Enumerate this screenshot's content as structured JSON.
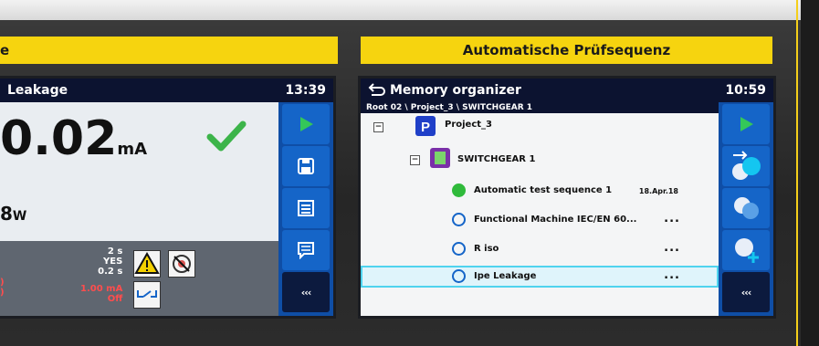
{
  "panels": {
    "left_label": "e",
    "right_label": "Automatische Prüfsequenz"
  },
  "left_screen": {
    "title": "Leakage",
    "time": "13:39",
    "main_value": "0.02",
    "main_unit": "mA",
    "power_value": "8",
    "power_unit": "W",
    "param_lines": [
      "2 s",
      "YES",
      "0.2 s"
    ],
    "limit_lines": [
      "1.00 mA",
      "Off"
    ],
    "left_red_lines": [
      ")",
      ")"
    ],
    "sidebar_last": "‹‹‹"
  },
  "right_screen": {
    "title": "Memory organizer",
    "time": "10:59",
    "path": "Root 02 \\ Project_3 \\ SWITCHGEAR 1",
    "tree": [
      {
        "label": "Project_3",
        "kind": "project"
      },
      {
        "label": "SWITCHGEAR 1",
        "kind": "switchgear"
      },
      {
        "label": "Automatic test sequence 1",
        "kind": "done",
        "date": "18.Apr.18"
      },
      {
        "label": "Functional Machine IEC/EN 60...",
        "kind": "empty",
        "dots": "..."
      },
      {
        "label": "R iso",
        "kind": "empty",
        "dots": "..."
      },
      {
        "label": "Ipe Leakage",
        "kind": "empty",
        "dots": "...",
        "selected": true
      }
    ],
    "sidebar_last": "‹‹‹"
  },
  "colors": {
    "accent_yellow": "#f6d40f",
    "screen_header": "#0c1330",
    "sidebar_blue": "#0f4ea6",
    "button_blue": "#1565c8",
    "pass_green": "#3cb44a",
    "select_cyan": "#4fd3ee"
  },
  "icons": {
    "play": "play-icon",
    "save": "save-icon",
    "list": "list-icon",
    "comment": "comment-icon",
    "back": "back-arrow-icon"
  }
}
